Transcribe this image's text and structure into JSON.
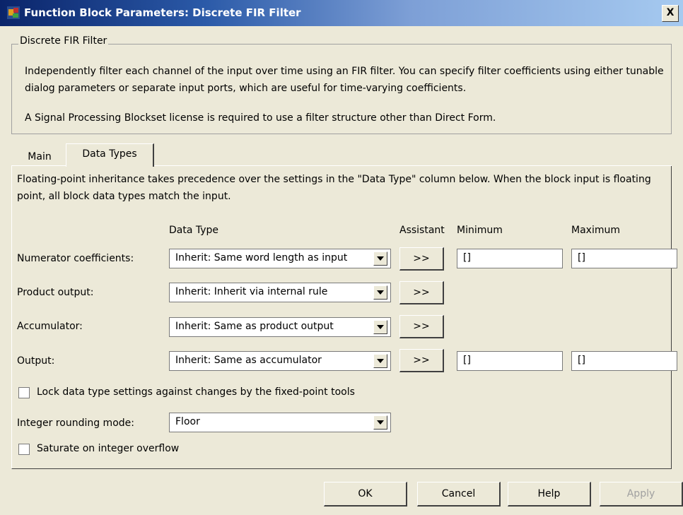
{
  "window": {
    "title": "Function Block Parameters: Discrete FIR Filter",
    "close_label": "X"
  },
  "group": {
    "legend": "Discrete FIR Filter",
    "description": "Independently filter each channel of the input over time using an FIR filter. You can specify filter coefficients using either tunable dialog parameters or separate input ports, which are useful for time-varying coefficients.",
    "license_note": "A Signal Processing Blockset license is required to use a filter structure other than Direct Form."
  },
  "tabs": [
    {
      "label": "Main",
      "active": false
    },
    {
      "label": "Data Types",
      "active": true
    }
  ],
  "panel": {
    "info": "Floating-point inheritance takes precedence over the settings in the \"Data Type\" column below. When the block input is floating point, all block data types match the input.",
    "headers": {
      "data_type": "Data Type",
      "assistant": "Assistant",
      "minimum": "Minimum",
      "maximum": "Maximum"
    },
    "rows": [
      {
        "label": "Numerator coefficients:",
        "data_type": "Inherit: Same word length as input",
        "assist": ">>",
        "minimum": "[]",
        "maximum": "[]"
      },
      {
        "label": "Product output:",
        "data_type": "Inherit: Inherit via internal rule",
        "assist": ">>"
      },
      {
        "label": "Accumulator:",
        "data_type": "Inherit: Same as product output",
        "assist": ">>"
      },
      {
        "label": "Output:",
        "data_type": "Inherit: Same as accumulator",
        "assist": ">>",
        "minimum": "[]",
        "maximum": "[]"
      }
    ],
    "lock_label": "Lock data type settings against changes by the fixed-point tools",
    "lock_checked": false,
    "rounding_label": "Integer rounding mode:",
    "rounding_value": "Floor",
    "saturate_label": "Saturate on integer overflow",
    "saturate_checked": false
  },
  "buttons": {
    "ok": "OK",
    "cancel": "Cancel",
    "help": "Help",
    "apply": "Apply"
  }
}
